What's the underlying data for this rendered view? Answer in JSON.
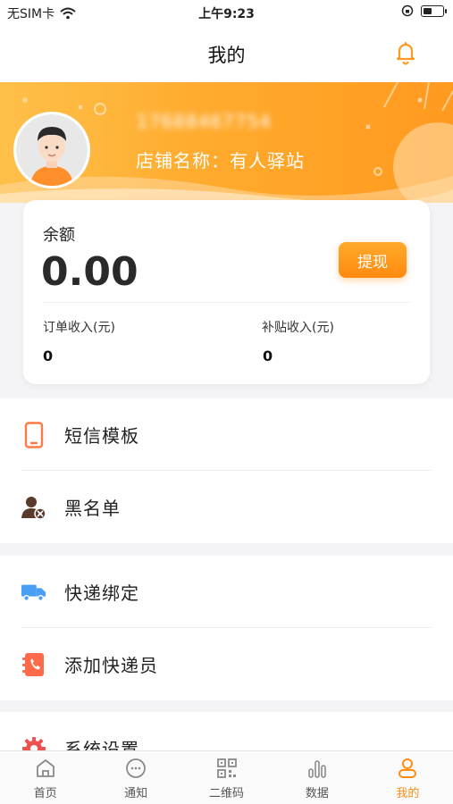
{
  "status_bar": {
    "carrier": "无SIM卡",
    "time": "上午9:23"
  },
  "nav": {
    "title": "我的"
  },
  "profile": {
    "phone": "17688467754",
    "shop_name": "店铺名称：有人驿站"
  },
  "balance": {
    "label": "余额",
    "value": "0.00",
    "withdraw_label": "提现",
    "order_income_label": "订单收入(元)",
    "order_income_value": "0",
    "subsidy_income_label": "补贴收入(元)",
    "subsidy_income_value": "0"
  },
  "menu_groups": [
    [
      {
        "label": "短信模板",
        "icon": "phone-icon",
        "color": "#ff7a45"
      },
      {
        "label": "黑名单",
        "icon": "user-block-icon",
        "color": "#5a3a2a"
      }
    ],
    [
      {
        "label": "快递绑定",
        "icon": "truck-icon",
        "color": "#4a9ff5"
      },
      {
        "label": "添加快递员",
        "icon": "contact-book-icon",
        "color": "#ff6b4a"
      }
    ],
    [
      {
        "label": "系统设置",
        "icon": "gear-icon",
        "color": "#f05050"
      }
    ]
  ],
  "tabs": [
    {
      "label": "首页",
      "icon": "home-icon",
      "active": false
    },
    {
      "label": "通知",
      "icon": "message-icon",
      "active": false
    },
    {
      "label": "二维码",
      "icon": "qrcode-icon",
      "active": false
    },
    {
      "label": "数据",
      "icon": "chart-icon",
      "active": false
    },
    {
      "label": "我的",
      "icon": "user-icon",
      "active": true
    }
  ],
  "colors": {
    "accent": "#ff8c12",
    "header_start": "#ffc04a",
    "header_end": "#ff9a1f"
  }
}
